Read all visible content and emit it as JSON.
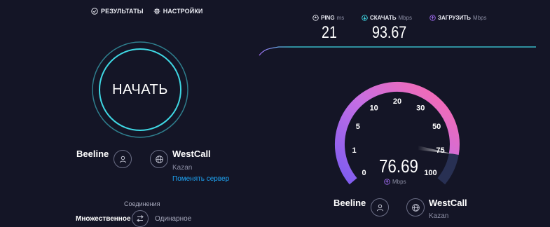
{
  "nav": {
    "results_label": "РЕЗУЛЬТАТЫ",
    "settings_label": "НАСТРОЙКИ"
  },
  "start_button_label": "НАЧАТЬ",
  "left": {
    "isp_name": "Beeline",
    "server_name": "WestCall",
    "server_location": "Kazan",
    "change_server_label": "Поменять сервер",
    "connections_label": "Соединения",
    "connection_multi": "Множественное",
    "connection_single": "Одинарное"
  },
  "metrics": {
    "ping": {
      "label": "PING",
      "unit": "ms",
      "value": "21"
    },
    "download": {
      "label": "СКАЧАТЬ",
      "unit": "Mbps",
      "value": "93.67"
    },
    "upload": {
      "label": "ЗАГРУЗИТЬ",
      "unit": "Mbps",
      "value": ""
    }
  },
  "gauge": {
    "scale_labels": [
      "0",
      "1",
      "5",
      "10",
      "20",
      "30",
      "50",
      "75",
      "100"
    ],
    "current_speed": "76.69",
    "unit": "Mbps",
    "current_value": 76.69
  },
  "bottom": {
    "isp_name": "Beeline",
    "server_name": "WestCall",
    "server_location": "Kazan"
  },
  "colors": {
    "background": "#141526",
    "accent_cyan": "#3fd8e4",
    "accent_blue": "#1ea5f5",
    "gauge_purple": "#a06cf0",
    "gauge_pink": "#f06ab8",
    "gauge_track": "#283053"
  }
}
